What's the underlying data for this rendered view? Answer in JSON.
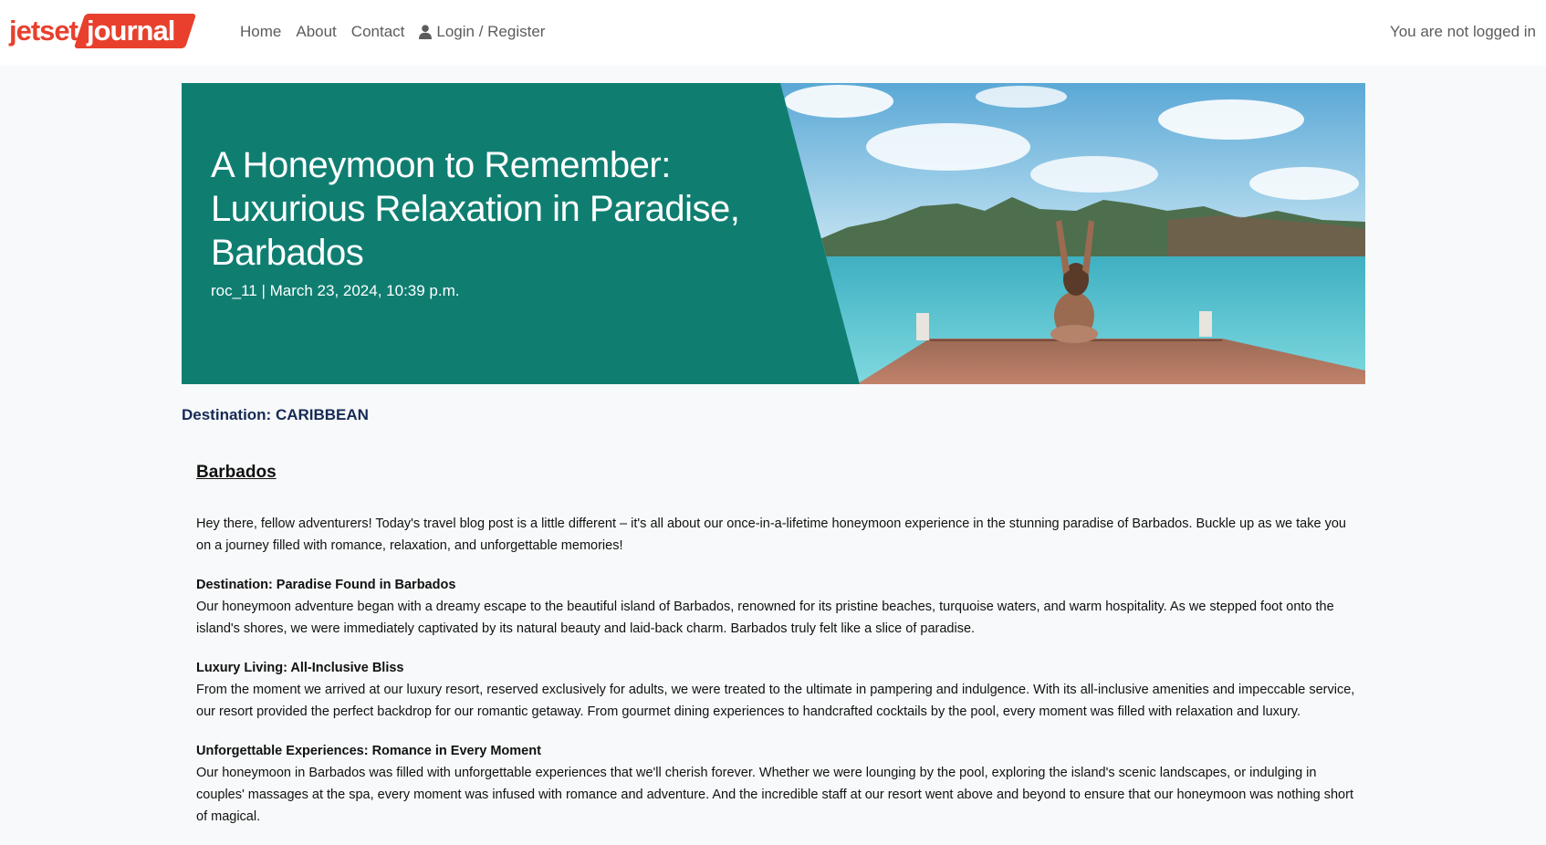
{
  "brand": {
    "part1": "jetset",
    "part2": "journal"
  },
  "nav": {
    "home": "Home",
    "about": "About",
    "contact": "Contact",
    "login": "Login / Register",
    "status": "You are not logged in"
  },
  "hero": {
    "title": "A Honeymoon to Remember: Luxurious Relaxation in Paradise, Barbados",
    "meta": "roc_11 | March 23, 2024, 10:39 p.m."
  },
  "destination": "Destination: CARIBBEAN",
  "article": {
    "heading": "Barbados",
    "intro": "Hey there, fellow adventurers! Today's travel blog post is a little different – it's all about our once-in-a-lifetime honeymoon experience in the stunning paradise of Barbados. Buckle up as we take you on a journey filled with romance, relaxation, and unforgettable memories!",
    "sections": [
      {
        "title": "Destination: Paradise Found in Barbados",
        "body": "Our honeymoon adventure began with a dreamy escape to the beautiful island of Barbados, renowned for its pristine beaches, turquoise waters, and warm hospitality. As we stepped foot onto the island's shores, we were immediately captivated by its natural beauty and laid-back charm. Barbados truly felt like a slice of paradise."
      },
      {
        "title": "Luxury Living: All-Inclusive Bliss",
        "body": "From the moment we arrived at our luxury resort, reserved exclusively for adults, we were treated to the ultimate in pampering and indulgence. With its all-inclusive amenities and impeccable service, our resort provided the perfect backdrop for our romantic getaway. From gourmet dining experiences to handcrafted cocktails by the pool, every moment was filled with relaxation and luxury."
      },
      {
        "title": "Unforgettable Experiences: Romance in Every Moment",
        "body": "Our honeymoon in Barbados was filled with unforgettable experiences that we'll cherish forever. Whether we were lounging by the pool, exploring the island's scenic landscapes, or indulging in couples' massages at the spa, every moment was infused with romance and adventure. And the incredible staff at our resort went above and beyond to ensure that our honeymoon was nothing short of magical."
      }
    ]
  },
  "colors": {
    "brand_red": "#e8402d",
    "hero_teal": "#0f7e71",
    "destination_navy": "#152a55"
  },
  "icons": {
    "login": "user-icon"
  }
}
